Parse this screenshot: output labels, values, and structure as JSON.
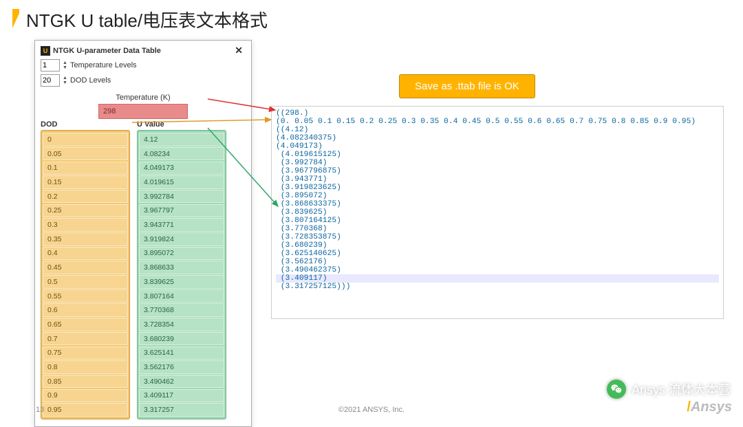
{
  "slide": {
    "title": "NTGK U table/电压表文本格式",
    "page": "13",
    "copyright": "©2021 ANSYS, Inc."
  },
  "panel": {
    "title": "NTGK U-parameter Data Table",
    "close": "✕",
    "temp_levels_label": "Temperature Levels",
    "temp_levels_value": "1",
    "dod_levels_label": "DOD Levels",
    "dod_levels_value": "20",
    "temp_header": "Temperature (K)",
    "temp_value": "298",
    "dod_header": "DOD",
    "u_header": "U Value",
    "dod": [
      "0",
      "0.05",
      "0.1",
      "0.15",
      "0.2",
      "0.25",
      "0.3",
      "0.35",
      "0.4",
      "0.45",
      "0.5",
      "0.55",
      "0.6",
      "0.65",
      "0.7",
      "0.75",
      "0.8",
      "0.85",
      "0.9",
      "0.95"
    ],
    "u": [
      "4.12",
      "4.08234",
      "4.049173",
      "4.019615",
      "3.992784",
      "3.967797",
      "3.943771",
      "3.919824",
      "3.895072",
      "3.868633",
      "3.839625",
      "3.807164",
      "3.770368",
      "3.728354",
      "3.680239",
      "3.625141",
      "3.562176",
      "3.490462",
      "3.409117",
      "3.317257"
    ]
  },
  "tag": {
    "text": "Save as .ttab file is OK"
  },
  "code": {
    "lines": [
      "((298.)",
      "(0. 0.05 0.1 0.15 0.2 0.25 0.3 0.35 0.4 0.45 0.5 0.55 0.6 0.65 0.7 0.75 0.8 0.85 0.9 0.95)",
      "((4.12)",
      "(4.082340375)",
      "(4.049173)",
      " (4.019615125)",
      " (3.992784)",
      " (3.967796875)",
      " (3.943771)",
      " (3.919823625)",
      " (3.895072)",
      " (3.868633375)",
      " (3.839625)",
      " (3.807164125)",
      " (3.770368)",
      " (3.728353875)",
      " (3.680239)",
      " (3.625140625)",
      " (3.562176)",
      " (3.490462375)",
      " (3.409117)",
      " (3.317257125)))"
    ],
    "highlight_index": 21
  },
  "watermark": {
    "text": "Ansys 流体大本营"
  },
  "logo": {
    "text": "Ansys",
    "slash": "/"
  },
  "chart_data": {
    "type": "table",
    "title": "NTGK U-parameter Data Table",
    "temperatures_K": [
      298
    ],
    "dod": [
      0,
      0.05,
      0.1,
      0.15,
      0.2,
      0.25,
      0.3,
      0.35,
      0.4,
      0.45,
      0.5,
      0.55,
      0.6,
      0.65,
      0.7,
      0.75,
      0.8,
      0.85,
      0.9,
      0.95
    ],
    "u_values": [
      4.12,
      4.082340375,
      4.049173,
      4.019615125,
      3.992784,
      3.967796875,
      3.943771,
      3.919823625,
      3.895072,
      3.868633375,
      3.839625,
      3.807164125,
      3.770368,
      3.728353875,
      3.680239,
      3.625140625,
      3.562176,
      3.490462375,
      3.409117,
      3.317257125
    ]
  }
}
